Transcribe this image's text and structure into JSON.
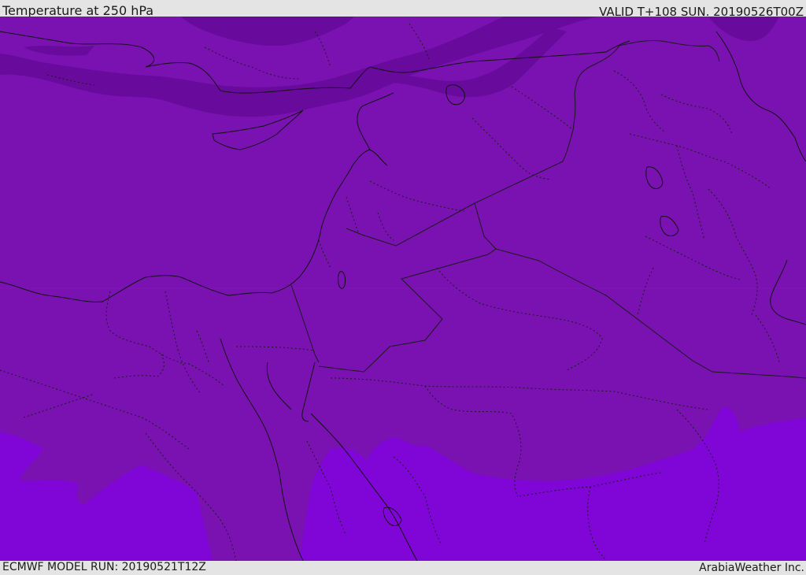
{
  "header": {
    "title": "Temperature at 250 hPa",
    "valid_time": "VALID T+108 SUN. 20190526T00Z"
  },
  "footer": {
    "model_run": "ECMWF MODEL RUN: 20190521T12Z",
    "provider": "ArabiaWeather Inc."
  },
  "map": {
    "field": "temperature-250hpa",
    "colors": {
      "base": "#7a12b2",
      "cold": "#680a9c",
      "warm": "#7f06d6",
      "coastline": "#111111",
      "border": "#1a1a1a"
    }
  }
}
